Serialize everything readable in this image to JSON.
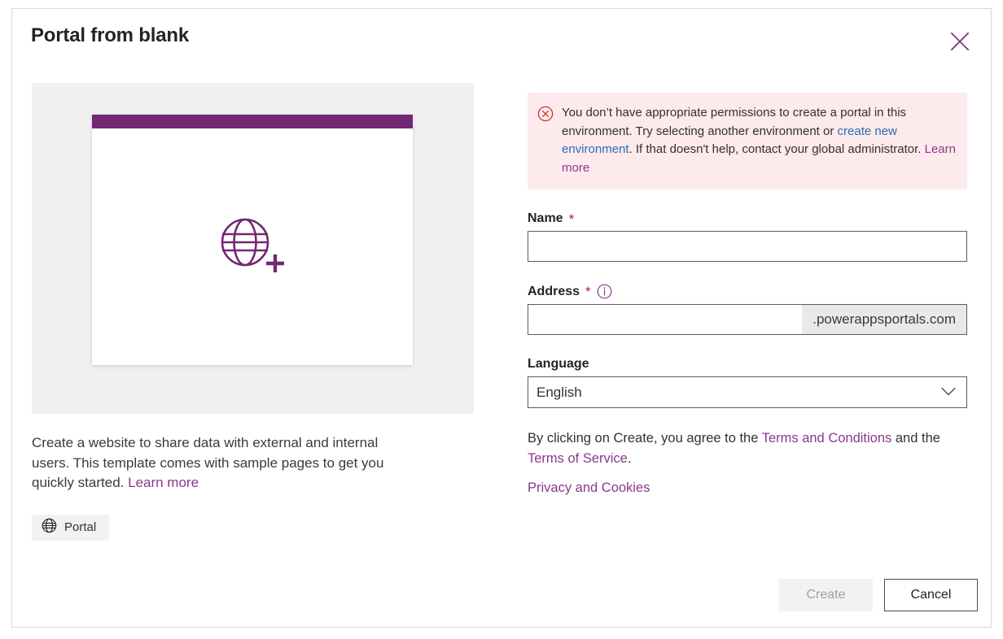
{
  "dialog": {
    "title": "Portal from blank",
    "close_icon": "close-icon"
  },
  "preview": {
    "icon": "globe-plus-icon",
    "bar_color": "#742774",
    "background_color": "#f1f0ef"
  },
  "template": {
    "description_part1": "Create a website to share data with external and internal users. This template comes with sample pages to get you quickly started. ",
    "learn_more_label": "Learn more",
    "tag": {
      "icon": "globe-icon",
      "label": "Portal"
    }
  },
  "error": {
    "icon": "error-circle-x-icon",
    "text_part1": "You don’t have appropriate permissions to create a portal in this environment. Try selecting another environment or ",
    "link_label": "create new environment",
    "text_part2": ". If that doesn't help, contact your global administrator. ",
    "learn_more_label": "Learn more",
    "background_color": "#fdeaec",
    "icon_color": "#c0392b",
    "link_color": "#2e6bb0"
  },
  "form": {
    "name": {
      "label": "Name",
      "required_marker": "*",
      "value": "",
      "placeholder": ""
    },
    "address": {
      "label": "Address",
      "required_marker": "*",
      "info_icon": "info-icon",
      "value": "",
      "placeholder": "",
      "suffix": ".powerappsportals.com"
    },
    "language": {
      "label": "Language",
      "value": "English",
      "chevron_icon": "chevron-down-icon",
      "options": [
        "English"
      ]
    }
  },
  "legal": {
    "text_part1": "By clicking on Create, you agree to the ",
    "terms_and_conditions_label": "Terms and Conditions",
    "text_part2": " and the ",
    "terms_of_service_label": "Terms of Service",
    "text_part3": ".",
    "privacy_label": "Privacy and Cookies"
  },
  "footer": {
    "create_label": "Create",
    "cancel_label": "Cancel"
  },
  "colors": {
    "accent_purple": "#742774",
    "link_purple": "#8a398a",
    "link_blue": "#2e6bb0",
    "required_red": "#a4262c"
  }
}
